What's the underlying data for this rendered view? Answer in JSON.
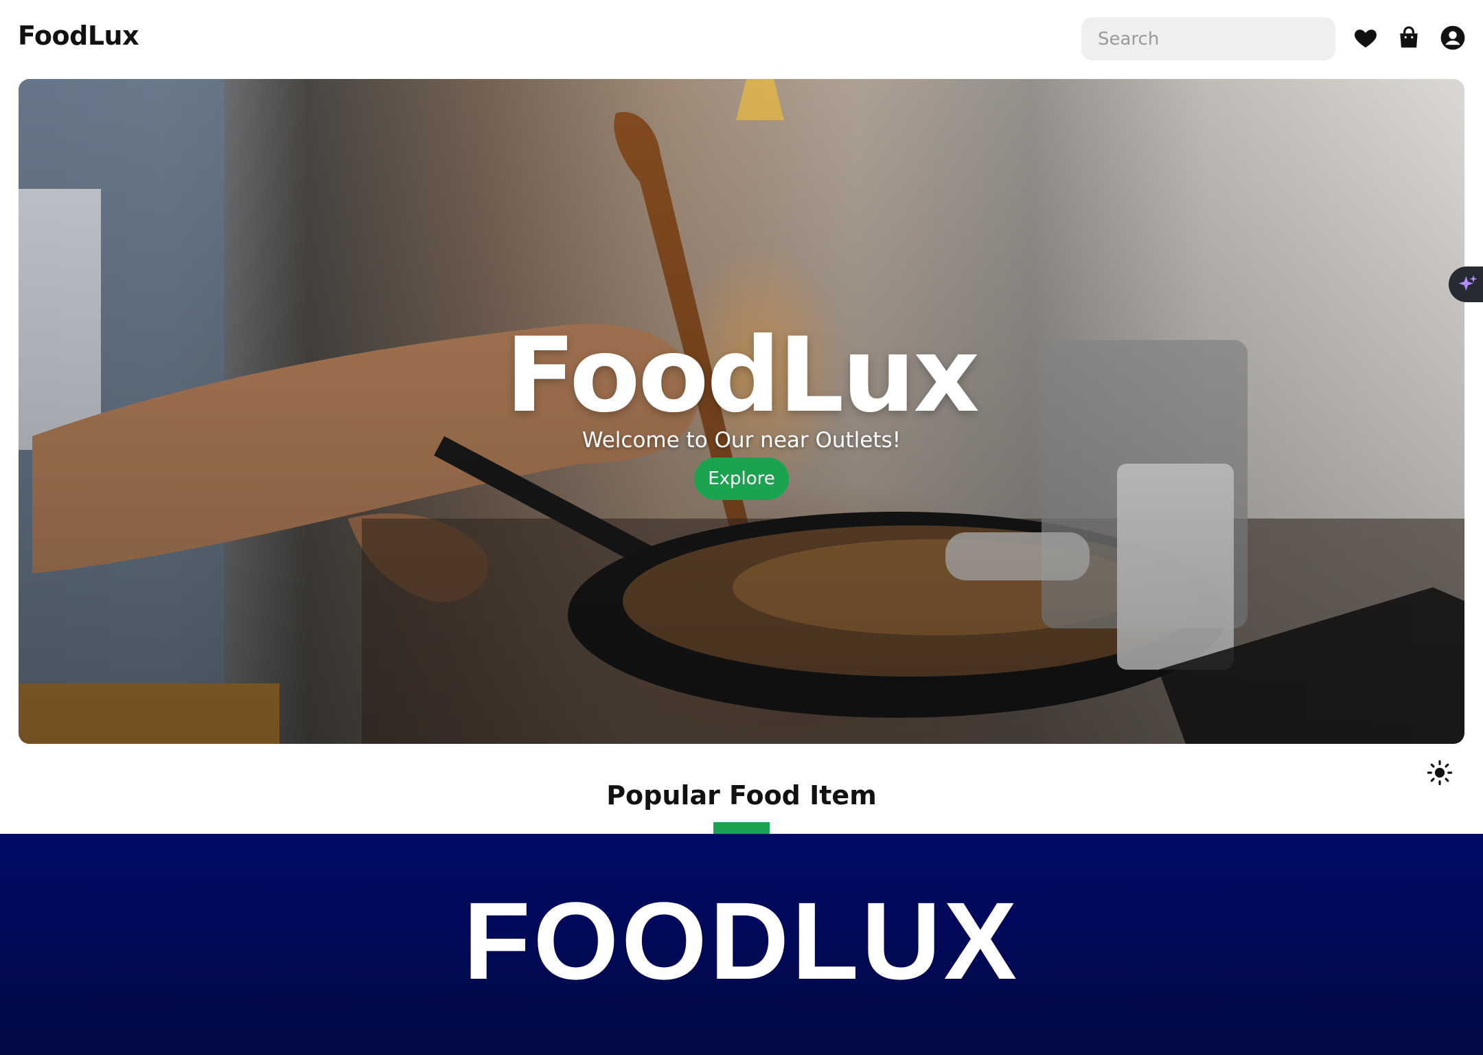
{
  "header": {
    "brand": "FoodLux",
    "search_placeholder": "Search",
    "icons": [
      "heart-icon",
      "shopping-bag-icon",
      "user-icon"
    ]
  },
  "hero": {
    "title": "FoodLux",
    "subtitle": "Welcome to Our near Outlets!",
    "cta_label": "Explore"
  },
  "section": {
    "title": "Popular Food Item"
  },
  "banner": {
    "text": "FOODLUX"
  },
  "colors": {
    "accent": "#1ca34f",
    "banner_top": "#020c66",
    "banner_bottom": "#010a43",
    "fab_bg": "#262a33",
    "fab_icon": "#b18cff"
  }
}
